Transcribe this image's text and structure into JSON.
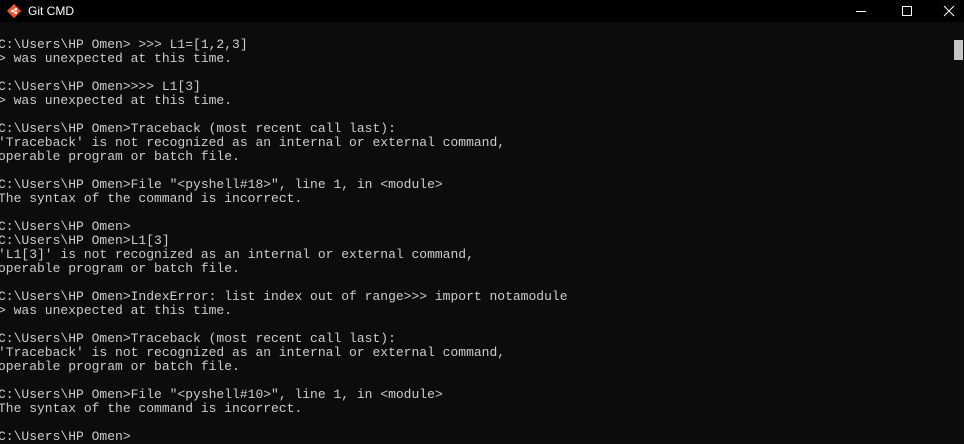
{
  "window": {
    "title": "Git CMD",
    "icon": "git-diamond-icon",
    "controls": [
      "minimize-icon",
      "maximize-icon",
      "close-icon"
    ]
  },
  "colors": {
    "background": "#0c0c0c",
    "text": "#cccccc",
    "titlebar": "#000000",
    "git_icon": "#f05133"
  },
  "console": {
    "lines": [
      "C:\\Users\\HP Omen> >>> L1=[1,2,3]",
      "> was unexpected at this time.",
      "",
      "C:\\Users\\HP Omen>>>> L1[3]",
      "> was unexpected at this time.",
      "",
      "C:\\Users\\HP Omen>Traceback (most recent call last):",
      "'Traceback' is not recognized as an internal or external command,",
      "operable program or batch file.",
      "",
      "C:\\Users\\HP Omen>File \"<pyshell#18>\", line 1, in <module>",
      "The syntax of the command is incorrect.",
      "",
      "C:\\Users\\HP Omen>",
      "C:\\Users\\HP Omen>L1[3]",
      "'L1[3]' is not recognized as an internal or external command,",
      "operable program or batch file.",
      "",
      "C:\\Users\\HP Omen>IndexError: list index out of range>>> import notamodule",
      "> was unexpected at this time.",
      "",
      "C:\\Users\\HP Omen>Traceback (most recent call last):",
      "'Traceback' is not recognized as an internal or external command,",
      "operable program or batch file.",
      "",
      "C:\\Users\\HP Omen>File \"<pyshell#10>\", line 1, in <module>",
      "The syntax of the command is incorrect.",
      "",
      "C:\\Users\\HP Omen>"
    ]
  }
}
